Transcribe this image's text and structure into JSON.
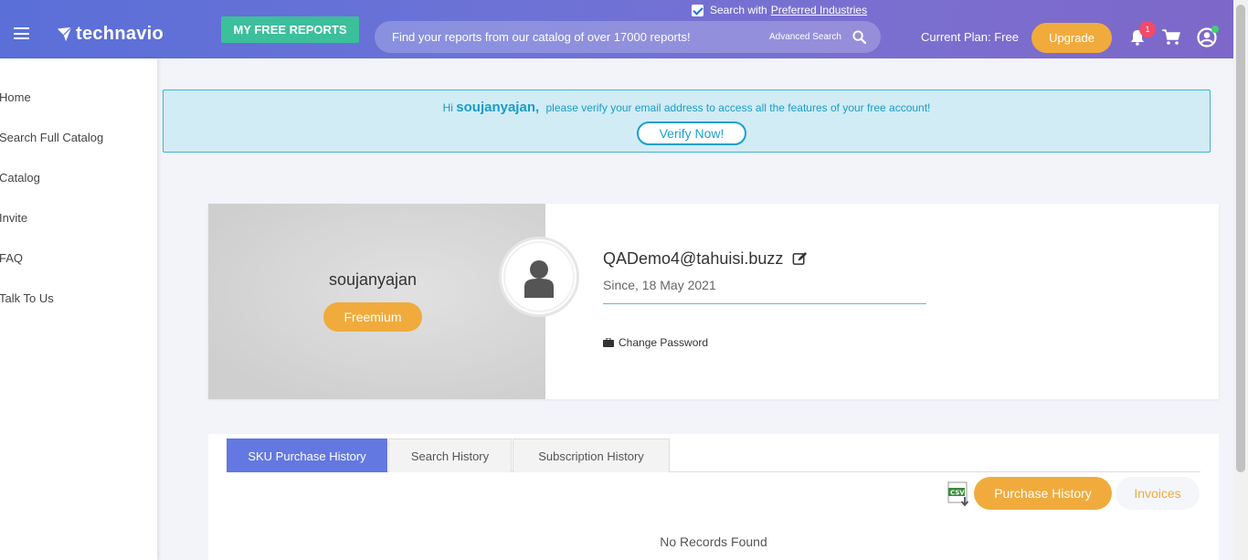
{
  "header": {
    "logo_text": "technavio",
    "free_reports_label": "MY FREE REPORTS",
    "search_placeholder": "Find your reports from our catalog of over 17000 reports!",
    "advanced_search_label": "Advanced Search",
    "preferred_prefix": "Search with",
    "preferred_link": "Preferred Industries",
    "current_plan": "Current Plan: Free",
    "upgrade_label": "Upgrade",
    "notification_count": "1"
  },
  "sidebar": {
    "items": [
      {
        "label": "Home"
      },
      {
        "label": "Search Full Catalog"
      },
      {
        "label": "Catalog"
      },
      {
        "label": "Invite"
      },
      {
        "label": "FAQ"
      },
      {
        "label": "Talk To Us"
      }
    ]
  },
  "alert": {
    "greeting": "Hi",
    "username": "soujanyajan,",
    "message": "please verify your email address to access all the features of your free account!",
    "verify_label": "Verify Now!"
  },
  "profile": {
    "username": "soujanyajan",
    "tier": "Freemium",
    "email": "QADemo4@tahuisi.buzz",
    "since": "Since, 18 May 2021",
    "change_password_label": "Change Password"
  },
  "history": {
    "tabs": [
      {
        "label": "SKU Purchase History",
        "active": true
      },
      {
        "label": "Search History",
        "active": false
      },
      {
        "label": "Subscription History",
        "active": false
      }
    ],
    "csv_icon_label": "CSV",
    "purchase_history_label": "Purchase History",
    "invoices_label": "Invoices",
    "empty_message": "No Records Found"
  },
  "colors": {
    "accent_orange": "#f0ab3c",
    "accent_blue": "#6378e0",
    "alert_bg": "#d1ecf4",
    "green_button": "#3cbf9b"
  }
}
